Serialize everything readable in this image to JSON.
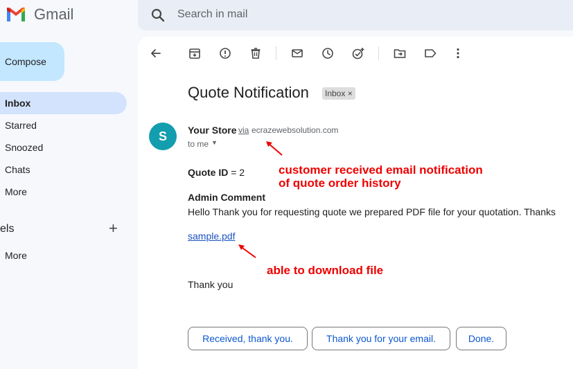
{
  "app": {
    "name": "Gmail"
  },
  "search": {
    "placeholder": "Search in mail"
  },
  "sidebar": {
    "compose_label": "Compose",
    "items": [
      {
        "label": "Inbox",
        "active": true
      },
      {
        "label": "Starred"
      },
      {
        "label": "Snoozed"
      },
      {
        "label": "Chats"
      },
      {
        "label": "More"
      }
    ],
    "labels_header": "els",
    "labels_more": "More"
  },
  "toolbar": {
    "icons": [
      "back-arrow-icon",
      "archive-icon",
      "report-spam-icon",
      "delete-icon",
      "mark-unread-icon",
      "snooze-icon",
      "add-task-icon",
      "move-to-icon",
      "label-icon",
      "more-vert-icon"
    ]
  },
  "email": {
    "subject": "Quote Notification",
    "label_chip": "Inbox",
    "sender_initial": "S",
    "sender_name": "Your Store",
    "via": "via",
    "sender_domain": "ecrazewebsolution.com",
    "to": "to me",
    "quote_id_label": "Quote ID",
    "quote_id_value": " = 2",
    "admin_comment_heading": "Admin Comment",
    "admin_comment": "Hello Thank you for requesting quote we prepared PDF file for your quotation. Thanks",
    "attachment": "sample.pdf",
    "closing": "Thank you"
  },
  "annotations": {
    "note1_line1": "customer received email notification",
    "note1_line2": "of quote order history",
    "note2": "able to download file"
  },
  "smart_replies": [
    "Received, thank you.",
    "Thank you for your email.",
    "Done."
  ],
  "colors": {
    "accent": "#0b57d0",
    "annotation": "#ee0000",
    "avatar": "#129eaf",
    "compose": "#c2e7ff"
  }
}
